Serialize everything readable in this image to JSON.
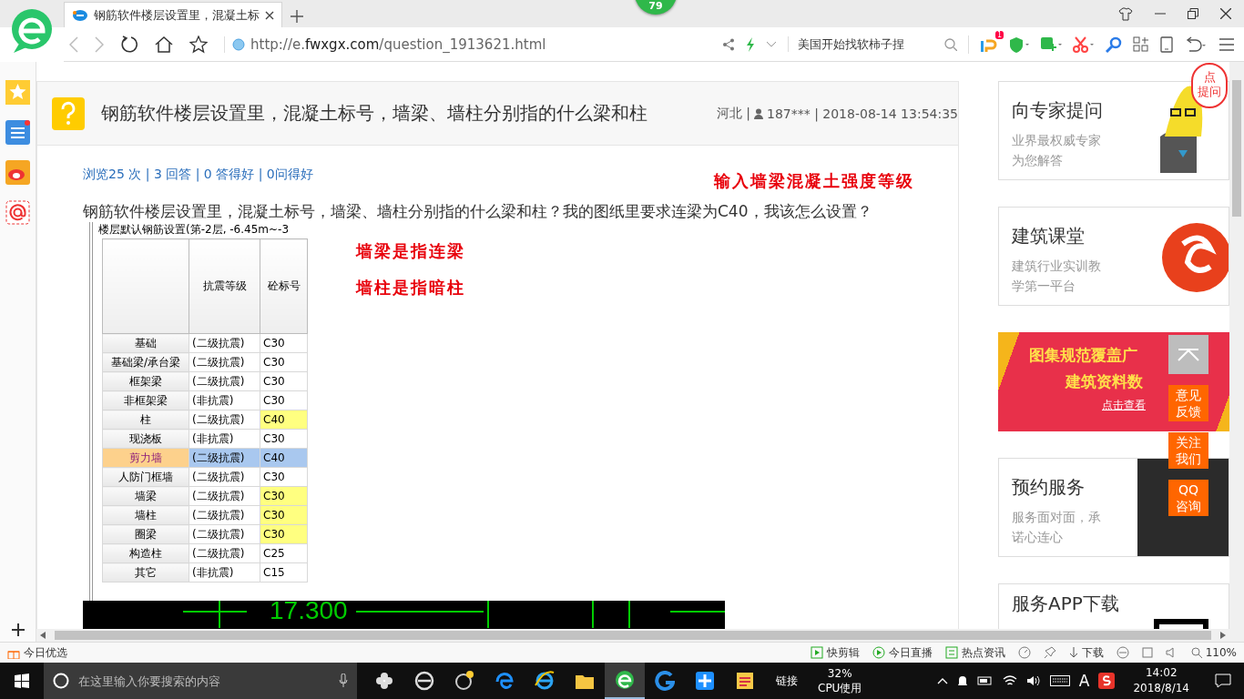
{
  "browser": {
    "tab": {
      "title": "钢筋软件楼层设置里，混凝土标",
      "selected": true
    },
    "badge": "79",
    "address": "http://e.fwxgx.com/question_1913621.html",
    "search": {
      "value": "美国开始找软柿子捏"
    },
    "ext_badge": "1"
  },
  "question": {
    "title": "钢筋软件楼层设置里，混凝土标号，墙梁、墙柱分别指的什么梁和柱",
    "meta_before": "河北 |",
    "meta_after": "187*** | 2018-08-14 13:54:35",
    "stats": "浏览25 次 | 3 回答 | 0 答得好 | 0问得好",
    "annotation": "输入墙梁混凝土强度等级",
    "body": "钢筋软件楼层设置里，混凝土标号，墙梁、墙柱分别指的什么梁和柱？我的图纸里要求连梁为C40，我该怎么设置？"
  },
  "figure": {
    "caption": "楼层默认钢筋设置(第-2层, -6.45m~-3",
    "columns": [
      "抗震等级",
      "砼标号"
    ],
    "rows": [
      {
        "name": "基础",
        "level": "(二级抗震)",
        "grade": "C30",
        "highlight": false,
        "selected": false
      },
      {
        "name": "基础梁/承台梁",
        "level": "(二级抗震)",
        "grade": "C30",
        "highlight": false,
        "selected": false
      },
      {
        "name": "框架梁",
        "level": "(二级抗震)",
        "grade": "C30",
        "highlight": false,
        "selected": false
      },
      {
        "name": "非框架梁",
        "level": "(非抗震)",
        "grade": "C30",
        "highlight": false,
        "selected": false
      },
      {
        "name": "柱",
        "level": "(二级抗震)",
        "grade": "C40",
        "highlight": true,
        "selected": false
      },
      {
        "name": "现浇板",
        "level": "(非抗震)",
        "grade": "C30",
        "highlight": false,
        "selected": false
      },
      {
        "name": "剪力墙",
        "level": "(二级抗震)",
        "grade": "C40",
        "highlight": false,
        "selected": true
      },
      {
        "name": "人防门框墙",
        "level": "(二级抗震)",
        "grade": "C30",
        "highlight": false,
        "selected": false
      },
      {
        "name": "墙梁",
        "level": "(二级抗震)",
        "grade": "C30",
        "highlight": true,
        "selected": false
      },
      {
        "name": "墙柱",
        "level": "(二级抗震)",
        "grade": "C30",
        "highlight": true,
        "selected": false
      },
      {
        "name": "圈梁",
        "level": "(二级抗震)",
        "grade": "C30",
        "highlight": true,
        "selected": false
      },
      {
        "name": "构造柱",
        "level": "(二级抗震)",
        "grade": "C25",
        "highlight": false,
        "selected": false
      },
      {
        "name": "其它",
        "level": "(非抗震)",
        "grade": "C15",
        "highlight": false,
        "selected": false
      }
    ],
    "cad_label": "17.300",
    "notes": [
      "墙梁是指连梁",
      "墙柱是指暗柱"
    ]
  },
  "side_cards": [
    {
      "kind": "mascot",
      "title": "向专家提问",
      "desc": "业界最权威专家为您解答",
      "bubble": [
        "点",
        "提问"
      ]
    },
    {
      "kind": "logo",
      "title": "建筑课堂",
      "desc": "建筑行业实训教学第一平台"
    },
    {
      "kind": "banner",
      "lines": [
        "图集规范覆盖广",
        "建筑资料数"
      ],
      "link": "点击查看"
    },
    {
      "kind": "photo",
      "title": "预约服务",
      "desc": "服务面对面，承诺心连心"
    },
    {
      "kind": "qr",
      "title": "服务APP下载"
    }
  ],
  "float_buttons": [
    "意见反馈",
    "关注我们",
    "QQ咨询"
  ],
  "status_bar": {
    "left": "今日优选",
    "items": [
      "快剪辑",
      "今日直播",
      "热点资讯"
    ],
    "download": "下载",
    "zoom": "110%"
  },
  "taskbar": {
    "search": {
      "placeholder": "在这里输入你要搜索的内容"
    },
    "apps": [
      {
        "kind": "pinwheel",
        "active": false
      },
      {
        "kind": "e-gray",
        "active": false
      },
      {
        "kind": "swirl",
        "active": false
      },
      {
        "kind": "edge",
        "active": false
      },
      {
        "kind": "ie",
        "active": false
      },
      {
        "kind": "folder",
        "active": false
      },
      {
        "kind": "e-green",
        "active": true
      },
      {
        "kind": "g-blue",
        "active": false
      },
      {
        "kind": "plus-blue",
        "active": false
      },
      {
        "kind": "notes",
        "active": false
      }
    ],
    "links": "链接",
    "cpu_value": "32%",
    "cpu_label": "CPU使用",
    "ime": "A",
    "time": "14:02",
    "date": "2018/8/14"
  }
}
